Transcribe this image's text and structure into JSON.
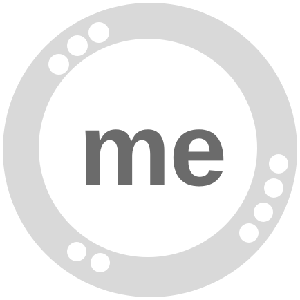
{
  "logo": {
    "text": "me",
    "icon": "me-ring-logo-icon",
    "colors": {
      "ring": "#d9d9d9",
      "inner": "#ffffff",
      "dots": "#ffffff",
      "text": "#6b6b6b",
      "background": "#ffffff"
    }
  }
}
